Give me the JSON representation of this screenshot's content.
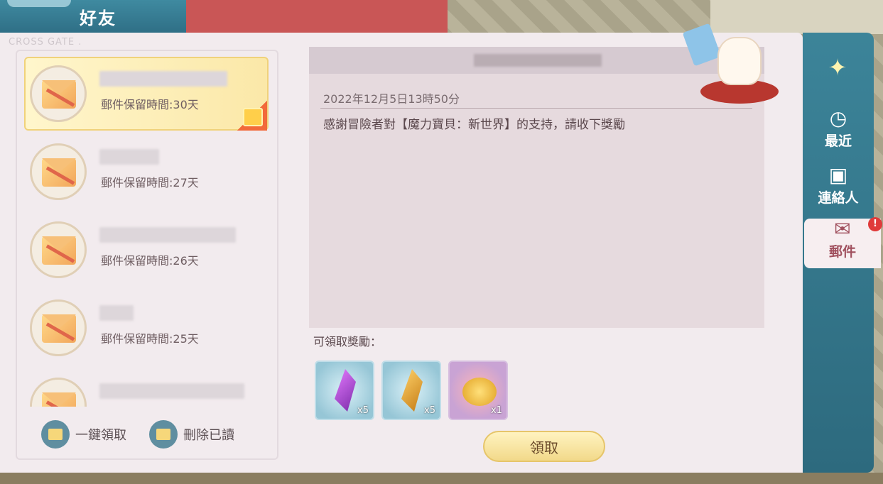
{
  "header": {
    "title": "好友"
  },
  "panel": {
    "watermark": "CROSS GATE ."
  },
  "mail_list": {
    "items": [
      {
        "keep_text": "郵件保留時間:30天",
        "selected": true
      },
      {
        "keep_text": "郵件保留時間:27天",
        "selected": false
      },
      {
        "keep_text": "郵件保留時間:26天",
        "selected": false
      },
      {
        "keep_text": "郵件保留時間:25天",
        "selected": false
      },
      {
        "keep_text": "",
        "selected": false
      }
    ],
    "actions": {
      "claim_all": "一鍵領取",
      "delete_read": "刪除已讀"
    }
  },
  "mail": {
    "date": "2022年12月5日13時50分",
    "body": "感謝冒險者對【魔力寶貝：新世界】的支持，請收下獎勵",
    "reward_label": "可領取獎勵：",
    "rewards": [
      {
        "icon": "purple-crystal-icon",
        "qty": "x5"
      },
      {
        "icon": "gold-crystal-icon",
        "qty": "x5"
      },
      {
        "icon": "gold-coin-icon",
        "qty": "x1"
      }
    ],
    "claim_button": "領取"
  },
  "sidebar": {
    "items": [
      {
        "label": "最近",
        "icon": "clock-icon"
      },
      {
        "label": "連絡人",
        "icon": "contact-icon"
      },
      {
        "label": "郵件",
        "icon": "mail-icon",
        "badge": "!"
      }
    ]
  },
  "colors": {
    "panel_bg": "#f2ebee",
    "sidebar_bg": "#3c8499",
    "accent_red": "#e03a3a"
  }
}
